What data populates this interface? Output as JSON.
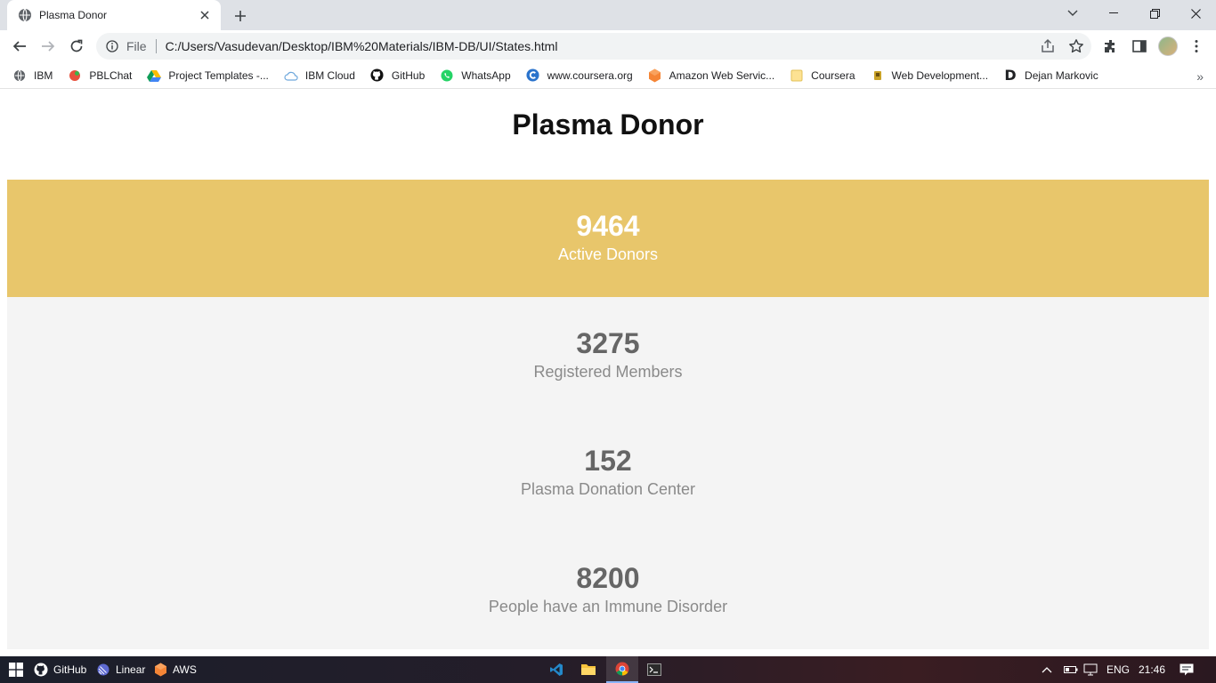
{
  "browser": {
    "tab": {
      "title": "Plasma Donor"
    },
    "address_bar": {
      "scheme_label": "File",
      "url": "C:/Users/Vasudevan/Desktop/IBM%20Materials/IBM-DB/UI/States.html"
    },
    "bookmarks": [
      {
        "label": "IBM",
        "icon": "globe-icon"
      },
      {
        "label": "PBLChat",
        "icon": "pblchat-icon"
      },
      {
        "label": "Project Templates -...",
        "icon": "google-drive-icon"
      },
      {
        "label": "IBM Cloud",
        "icon": "cloud-icon"
      },
      {
        "label": "GitHub",
        "icon": "github-icon"
      },
      {
        "label": "WhatsApp",
        "icon": "whatsapp-icon"
      },
      {
        "label": "www.coursera.org",
        "icon": "coursera-icon"
      },
      {
        "label": "Amazon Web Servic...",
        "icon": "aws-icon"
      },
      {
        "label": "Coursera",
        "icon": "folder-icon"
      },
      {
        "label": "Web Development...",
        "icon": "bookmark-icon"
      },
      {
        "label": "Dejan Markovic",
        "icon": "d-logo-icon"
      }
    ]
  },
  "page": {
    "title": "Plasma Donor",
    "stats": [
      {
        "value": "9464",
        "label": "Active Donors"
      },
      {
        "value": "3275",
        "label": "Registered Members"
      },
      {
        "value": "152",
        "label": "Plasma Donation Center"
      },
      {
        "value": "8200",
        "label": "People have an Immune Disorder"
      }
    ],
    "highlight_color": "#e8c66b"
  },
  "taskbar": {
    "pinned": [
      {
        "label": "GitHub",
        "icon": "github-icon"
      },
      {
        "label": "Linear",
        "icon": "linear-icon"
      },
      {
        "label": "AWS",
        "icon": "aws-icon"
      }
    ],
    "language": "ENG",
    "time": "21:46"
  }
}
